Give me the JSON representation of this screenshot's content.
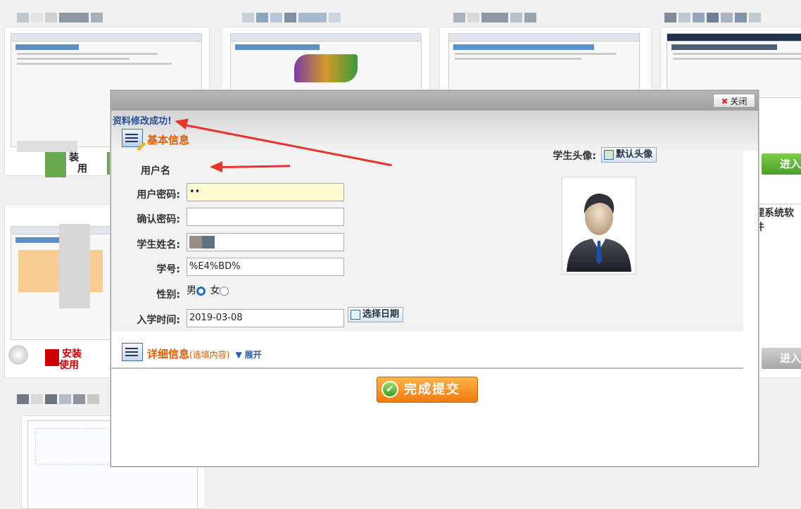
{
  "background": {
    "install_text_1": "装",
    "install_text_2": "用",
    "install_text_3": "安装",
    "install_text_4": "使用",
    "enter_label": "进入",
    "system_text": "理系统软件"
  },
  "modal": {
    "close_label": "关闭",
    "success_message": "资料修改成功!",
    "basic_section_title": "基本信息",
    "fields": {
      "username_label": "用户名",
      "password_label": "用户密码:",
      "password_value": "••",
      "confirm_label": "确认密码:",
      "confirm_value": "",
      "name_label": "学生姓名:",
      "student_no_label": "学号:",
      "student_no_value": "%E4%BD%",
      "gender_label": "性别:",
      "gender_male": "男",
      "gender_female": "女",
      "enroll_label": "入学时间:",
      "enroll_value": "2019-03-08",
      "date_picker_label": "选择日期"
    },
    "avatar_label": "学生头像:",
    "default_avatar_label": "默认头像",
    "detail_section_title": "详细信息",
    "detail_optional": "(选填内容)",
    "expand_label": "展开",
    "submit_label": "完成提交"
  },
  "colors": {
    "accent_orange": "#e05a00",
    "success_blue": "#2b4f96",
    "annotation_red": "#e8322a"
  }
}
